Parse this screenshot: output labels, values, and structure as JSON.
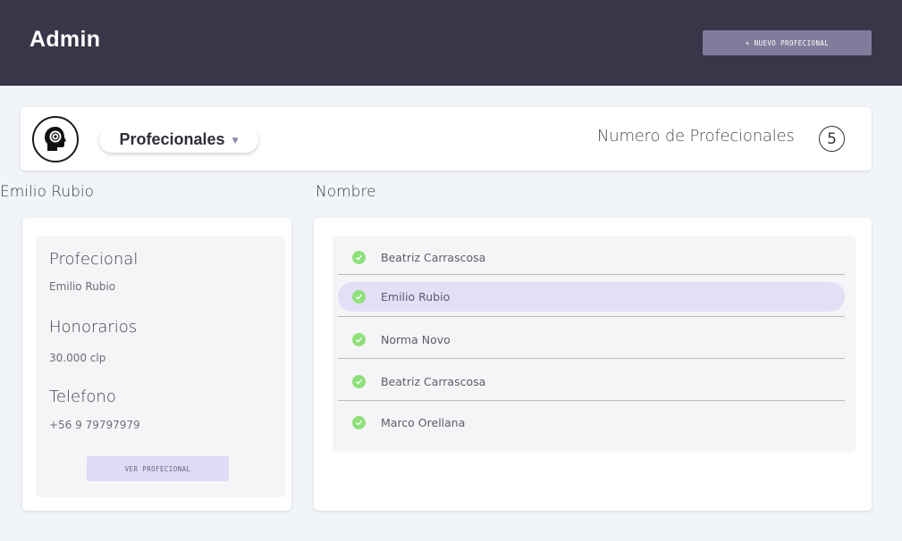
{
  "header": {
    "title": "Admin",
    "new_button_label": "+ NUEVO PROFECIONAL"
  },
  "toolbar": {
    "logo_icon": "head-profile-icon",
    "dropdown_label": "Profecionales",
    "dropdown_caret": "▼",
    "count_label": "Numero de Profecionales",
    "count_value": "5"
  },
  "detail": {
    "section_title": "Emilio Rubio",
    "fields": [
      {
        "label": "Profecional",
        "value": "Emilio Rubio"
      },
      {
        "label": "Honorarios",
        "value": "30.000 clp"
      },
      {
        "label": "Telefono",
        "value": "+56 9 79797979"
      }
    ],
    "view_button_label": "VER PROFECIONAL"
  },
  "list": {
    "section_title": "Nombre",
    "items": [
      {
        "name": "Beatriz Carrascosa",
        "selected": false,
        "icon": "check-circle-icon"
      },
      {
        "name": "Emilio Rubio",
        "selected": true,
        "icon": "check-circle-icon"
      },
      {
        "name": "Norma Novo",
        "selected": false,
        "icon": "check-circle-icon"
      },
      {
        "name": "Beatriz Carrascosa",
        "selected": false,
        "icon": "check-circle-icon"
      },
      {
        "name": "Marco Orellana",
        "selected": false,
        "icon": "check-circle-icon"
      }
    ]
  },
  "colors": {
    "topbar": "#3b3549",
    "accent_button": "#817c9b",
    "selected_row": "#e2dff7",
    "check": "#8fe07a",
    "background": "#f1f4f9"
  }
}
